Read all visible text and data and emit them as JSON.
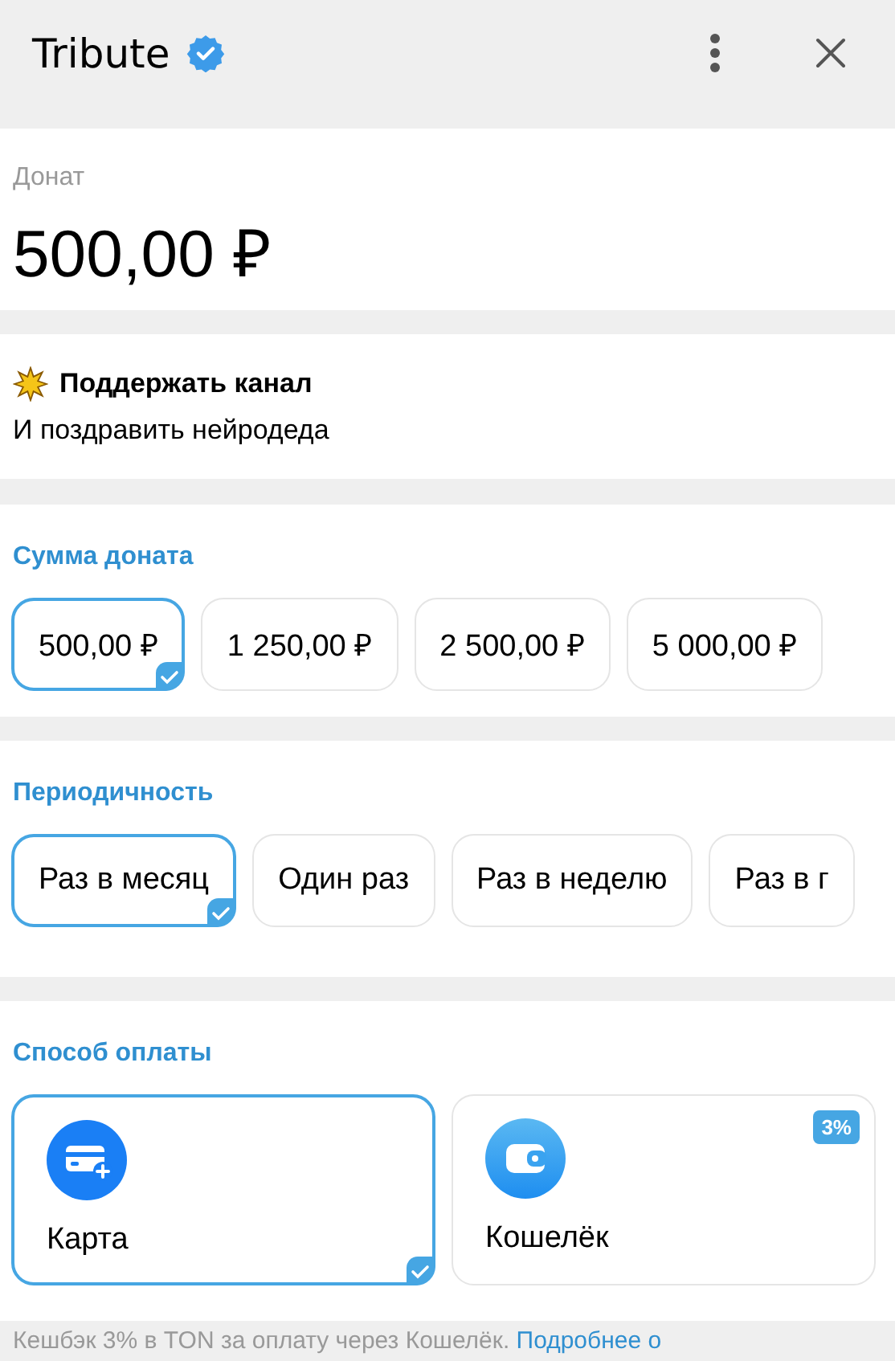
{
  "header": {
    "title": "Tribute",
    "verified": true
  },
  "donation": {
    "label": "Донат",
    "amount": "500,00 ₽"
  },
  "channel": {
    "title": "Поддержать канал",
    "subtitle": "И поздравить нейродеда"
  },
  "amount_section": {
    "title": "Сумма доната",
    "options": [
      {
        "label": "500,00 ₽",
        "selected": true
      },
      {
        "label": "1 250,00 ₽",
        "selected": false
      },
      {
        "label": "2 500,00 ₽",
        "selected": false
      },
      {
        "label": "5 000,00 ₽",
        "selected": false
      }
    ]
  },
  "period_section": {
    "title": "Периодичность",
    "options": [
      {
        "label": "Раз в месяц",
        "selected": true
      },
      {
        "label": "Один раз",
        "selected": false
      },
      {
        "label": "Раз в неделю",
        "selected": false
      },
      {
        "label": "Раз в г",
        "selected": false
      }
    ]
  },
  "payment_section": {
    "title": "Способ оплаты",
    "methods": [
      {
        "kind": "card",
        "label": "Карта",
        "selected": true
      },
      {
        "kind": "wallet",
        "label": "Кошелёк",
        "selected": false,
        "badge": "3%"
      }
    ]
  },
  "footer": {
    "text": "Кешбэк 3% в TON за оплату через Кошелёк.",
    "link": "Подробнее о"
  }
}
